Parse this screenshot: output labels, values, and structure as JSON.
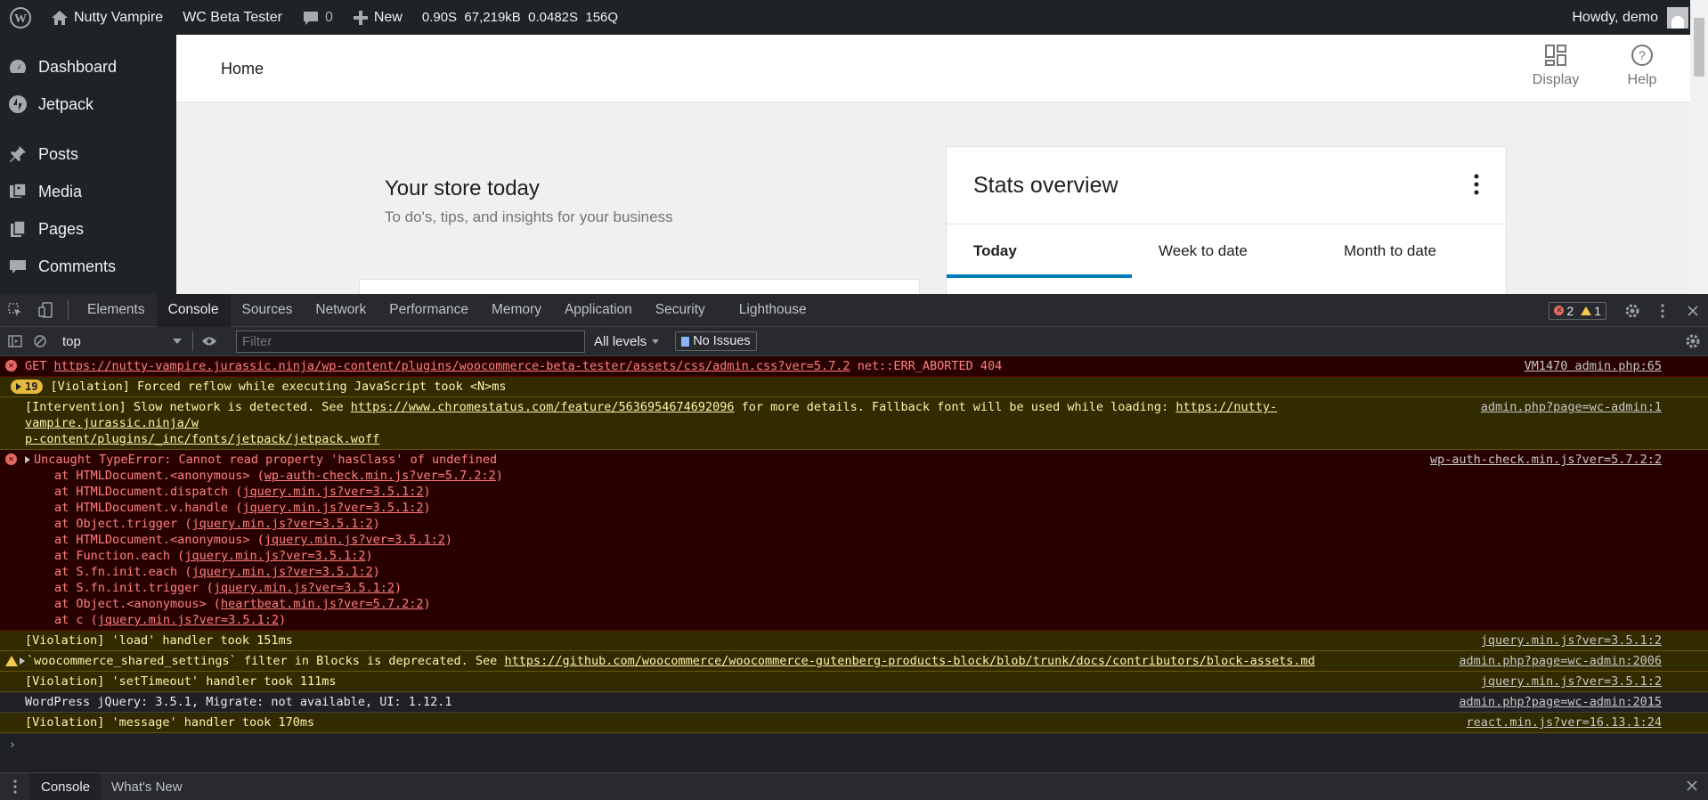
{
  "adminbar": {
    "site": "Nutty Vampire",
    "beta": "WC Beta Tester",
    "comments_count": "0",
    "new_label": "New",
    "perf": [
      "0.90S",
      "67,219kB",
      "0.0482S",
      "156Q"
    ],
    "howdy": "Howdy, demo"
  },
  "sidebar": {
    "items": [
      {
        "label": "Dashboard",
        "icon": "dashboard-icon"
      },
      {
        "label": "Jetpack",
        "icon": "jetpack-icon"
      },
      {
        "label": "Posts",
        "icon": "pin-icon"
      },
      {
        "label": "Media",
        "icon": "media-icon"
      },
      {
        "label": "Pages",
        "icon": "pages-icon"
      },
      {
        "label": "Comments",
        "icon": "comment-icon"
      }
    ]
  },
  "header": {
    "title": "Home",
    "display": "Display",
    "help": "Help"
  },
  "store": {
    "heading": "Your store today",
    "subheading": "To do's, tips, and insights for your business"
  },
  "stats": {
    "title": "Stats overview",
    "tabs": [
      "Today",
      "Week to date",
      "Month to date"
    ]
  },
  "devtools": {
    "tabs": [
      "Elements",
      "Console",
      "Sources",
      "Network",
      "Performance",
      "Memory",
      "Application",
      "Security",
      "Lighthouse"
    ],
    "errors": "2",
    "warnings": "1",
    "context": "top",
    "filter_placeholder": "Filter",
    "levels": "All levels",
    "issues": "No Issues",
    "drawer_tabs": [
      "Console",
      "What's New"
    ]
  },
  "console": {
    "m1": {
      "pre": "GET ",
      "url": "https://nutty-vampire.jurassic.ninja/wp-content/plugins/woocommerce-beta-tester/assets/css/admin.css?ver=5.7.2",
      "post": " net::ERR_ABORTED 404",
      "src": "VM1470 admin.php:65"
    },
    "m2": {
      "count": "19",
      "text": "[Violation] Forced reflow while executing JavaScript took <N>ms"
    },
    "m3": {
      "pre": "[Intervention] Slow network is detected. See ",
      "url1": "https://www.chromestatus.com/feature/5636954674692096",
      "mid": " for more details. Fallback font will be used while loading: ",
      "url2a": "https://nutty-vampire.jurassic.ninja/w",
      "url2b": "p-content/plugins/_inc/fonts/jetpack/jetpack.woff",
      "src": "admin.php?page=wc-admin:1"
    },
    "m4": {
      "text": "Uncaught TypeError: Cannot read property 'hasClass' of undefined",
      "src": "wp-auth-check.min.js?ver=5.7.2:2",
      "frames": [
        {
          "fn": "at HTMLDocument.<anonymous> (",
          "file": "wp-auth-check.min.js?ver=5.7.2:2"
        },
        {
          "fn": "at HTMLDocument.dispatch (",
          "file": "jquery.min.js?ver=3.5.1:2"
        },
        {
          "fn": "at HTMLDocument.v.handle (",
          "file": "jquery.min.js?ver=3.5.1:2"
        },
        {
          "fn": "at Object.trigger (",
          "file": "jquery.min.js?ver=3.5.1:2"
        },
        {
          "fn": "at HTMLDocument.<anonymous> (",
          "file": "jquery.min.js?ver=3.5.1:2"
        },
        {
          "fn": "at Function.each (",
          "file": "jquery.min.js?ver=3.5.1:2"
        },
        {
          "fn": "at S.fn.init.each (",
          "file": "jquery.min.js?ver=3.5.1:2"
        },
        {
          "fn": "at S.fn.init.trigger (",
          "file": "jquery.min.js?ver=3.5.1:2"
        },
        {
          "fn": "at Object.<anonymous> (",
          "file": "heartbeat.min.js?ver=5.7.2:2"
        },
        {
          "fn": "at c (",
          "file": "jquery.min.js?ver=3.5.1:2"
        }
      ]
    },
    "m5": {
      "text": "[Violation] 'load' handler took 151ms",
      "src": "jquery.min.js?ver=3.5.1:2"
    },
    "m6": {
      "pre": "`woocommerce_shared_settings` filter in Blocks is deprecated. See ",
      "url": "https://github.com/woocommerce/woocommerce-gutenberg-products-block/blob/trunk/docs/contributors/block-assets.md",
      "src": "admin.php?page=wc-admin:2006"
    },
    "m7": {
      "text": "[Violation] 'setTimeout' handler took 111ms",
      "src": "jquery.min.js?ver=3.5.1:2"
    },
    "m8": {
      "text": "WordPress jQuery: 3.5.1, Migrate: not available, UI: 1.12.1",
      "src": "admin.php?page=wc-admin:2015"
    },
    "m9": {
      "text": "[Violation] 'message' handler took 170ms",
      "src": "react.min.js?ver=16.13.1:24"
    }
  }
}
